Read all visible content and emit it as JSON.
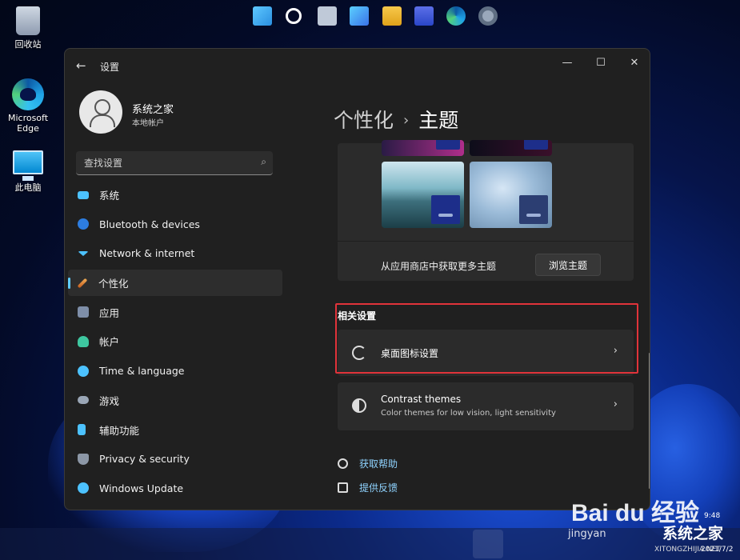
{
  "desktop": {
    "icons": [
      {
        "label": "回收站"
      },
      {
        "label": "Microsoft Edge"
      },
      {
        "label": "此电脑"
      }
    ]
  },
  "window": {
    "title": "设置",
    "controls": {
      "minimize": "—",
      "maximize": "☐",
      "close": "✕"
    }
  },
  "profile": {
    "name": "系统之家",
    "account_type": "本地帐户"
  },
  "search": {
    "placeholder": "查找设置"
  },
  "sidebar": {
    "items": [
      {
        "label": "系统",
        "icon": "system-icon"
      },
      {
        "label": "Bluetooth & devices",
        "icon": "bluetooth-icon"
      },
      {
        "label": "Network & internet",
        "icon": "wifi-icon"
      },
      {
        "label": "个性化",
        "icon": "brush-icon",
        "active": true
      },
      {
        "label": "应用",
        "icon": "apps-icon"
      },
      {
        "label": "帐户",
        "icon": "person-icon"
      },
      {
        "label": "Time & language",
        "icon": "globe-clock-icon"
      },
      {
        "label": "游戏",
        "icon": "gamepad-icon"
      },
      {
        "label": "辅助功能",
        "icon": "accessibility-icon"
      },
      {
        "label": "Privacy & security",
        "icon": "shield-icon"
      },
      {
        "label": "Windows Update",
        "icon": "update-icon"
      }
    ]
  },
  "breadcrumb": {
    "parent": "个性化",
    "separator": "›",
    "current": "主题"
  },
  "themes": {
    "store_text": "从应用商店中获取更多主题",
    "browse_label": "浏览主题"
  },
  "related": {
    "title": "相关设置",
    "desktop_icons": {
      "label": "桌面图标设置"
    },
    "contrast": {
      "label": "Contrast themes",
      "description": "Color themes for low vision, light sensitivity"
    }
  },
  "links": {
    "help": "获取帮助",
    "feedback": "提供反馈"
  },
  "watermark": {
    "baidu": "Bai du 经验",
    "jingyan": "jingyan",
    "site": "系统之家",
    "pinyin": "XITONGZHIJIA.NET"
  },
  "tray": {
    "time": "9:48",
    "date": "2021/7/2"
  },
  "colors": {
    "accent": "#60cdff",
    "highlight_box": "#e0333a",
    "window_bg": "#202020",
    "card_bg": "#2b2b2b"
  }
}
